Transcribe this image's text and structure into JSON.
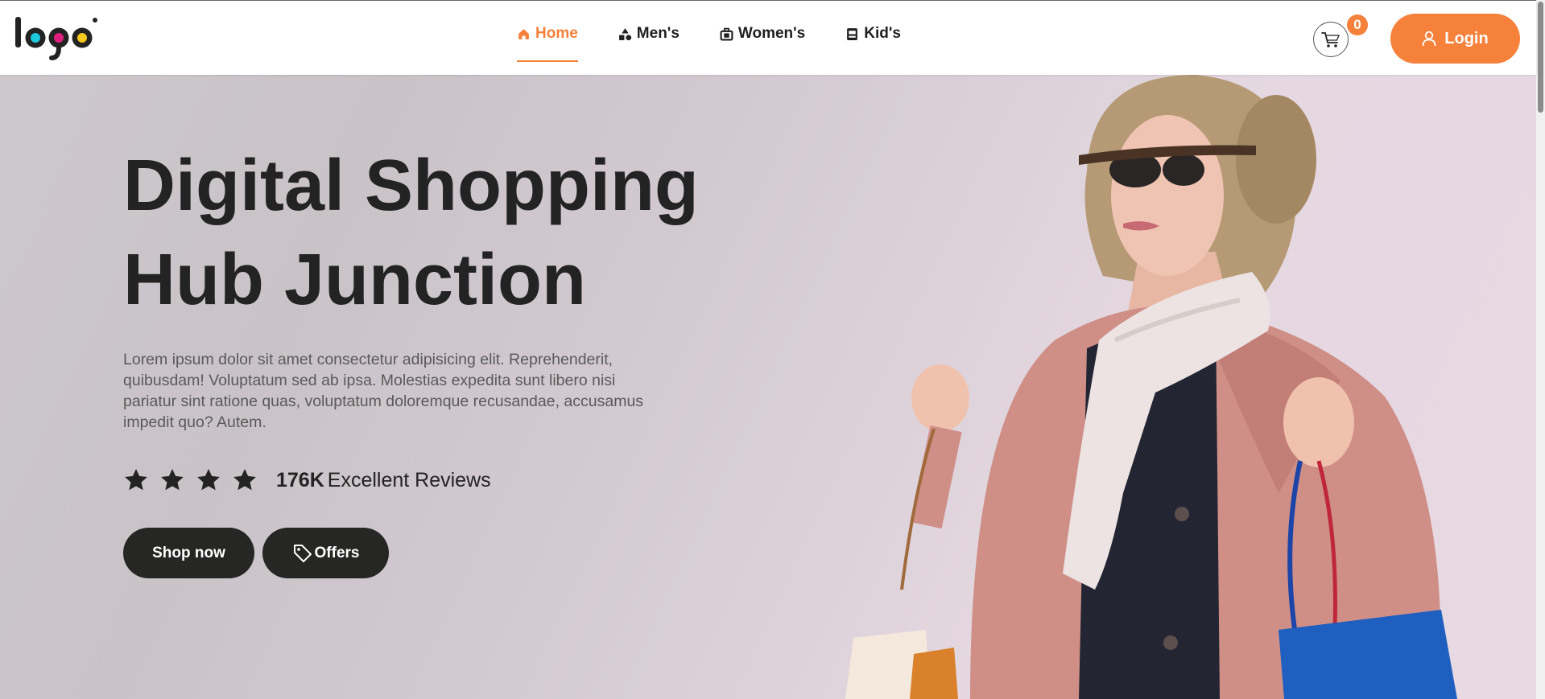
{
  "header": {
    "logo_text": "logo",
    "nav": [
      {
        "label": "Home",
        "icon": "home-icon",
        "active": true
      },
      {
        "label": "Men's",
        "icon": "shapes-icon",
        "active": false
      },
      {
        "label": "Women's",
        "icon": "briefcase-icon",
        "active": false
      },
      {
        "label": "Kid's",
        "icon": "contact-card-icon",
        "active": false
      }
    ],
    "cart_count": "0",
    "login_label": "Login"
  },
  "hero": {
    "title_line1": "Digital Shopping",
    "title_line2": "Hub Junction",
    "description": "Lorem ipsum dolor sit amet consectetur adipisicing elit. Reprehenderit, quibusdam! Voluptatum sed ab ipsa. Molestias expedita sunt libero nisi pariatur sint ratione quas, voluptatum doloremque recusandae, accusamus impedit quo? Autem.",
    "rating_stars": 4,
    "reviews_count": "176K",
    "reviews_label": "Excellent Reviews",
    "shop_label": "Shop now",
    "offers_label": "Offers"
  },
  "colors": {
    "accent": "#f5813a",
    "dark_button": "#262724",
    "heading": "#232323"
  }
}
